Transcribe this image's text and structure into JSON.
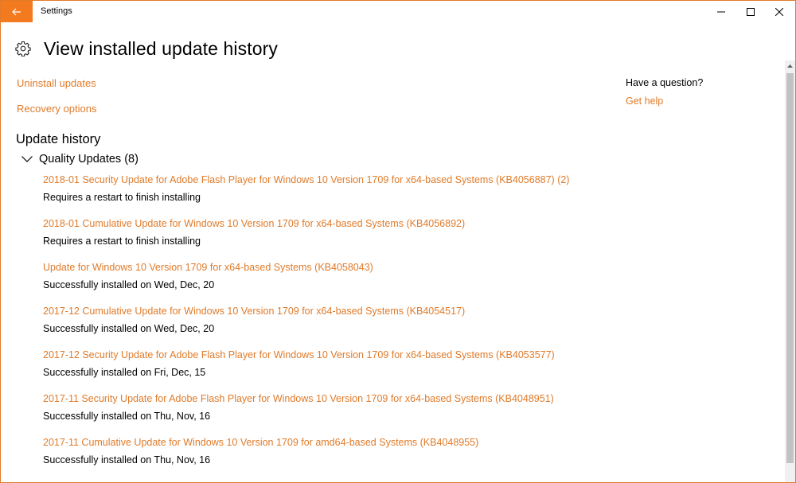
{
  "window": {
    "title": "Settings",
    "accent": "#f47a20",
    "link_color": "#e07b2a"
  },
  "header": {
    "title": "View installed update history",
    "icon": "gear-icon"
  },
  "links": {
    "uninstall": "Uninstall updates",
    "recovery": "Recovery options"
  },
  "sidebar": {
    "question": "Have a question?",
    "get_help": "Get help"
  },
  "history": {
    "title": "Update history",
    "group_label": "Quality Updates (8)",
    "items": [
      {
        "title": "2018-01 Security Update for Adobe Flash Player for Windows 10 Version 1709 for x64-based Systems (KB4056887) (2)",
        "status": "Requires a restart to finish installing"
      },
      {
        "title": "2018-01 Cumulative Update for Windows 10 Version 1709 for x64-based Systems (KB4056892)",
        "status": "Requires a restart to finish installing"
      },
      {
        "title": "Update for Windows 10 Version 1709 for x64-based Systems (KB4058043)",
        "status": "Successfully installed on Wed, Dec, 20"
      },
      {
        "title": "2017-12 Cumulative Update for Windows 10 Version 1709 for x64-based Systems (KB4054517)",
        "status": "Successfully installed on Wed, Dec, 20"
      },
      {
        "title": "2017-12 Security Update for Adobe Flash Player for Windows 10 Version 1709 for x64-based Systems (KB4053577)",
        "status": "Successfully installed on Fri, Dec, 15"
      },
      {
        "title": "2017-11 Security Update for Adobe Flash Player for Windows 10 Version 1709 for x64-based Systems (KB4048951)",
        "status": "Successfully installed on Thu, Nov, 16"
      },
      {
        "title": "2017-11 Cumulative Update for Windows 10 Version 1709 for amd64-based Systems (KB4048955)",
        "status": "Successfully installed on Thu, Nov, 16"
      }
    ]
  }
}
